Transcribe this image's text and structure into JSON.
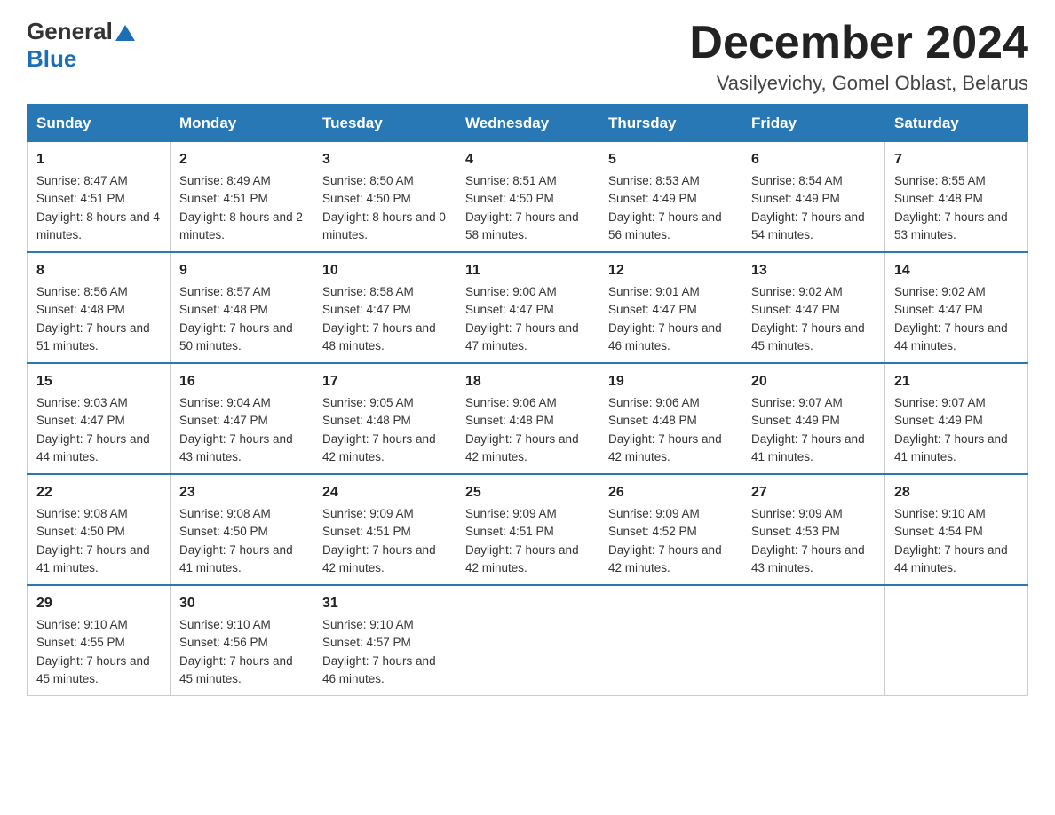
{
  "header": {
    "logo_general": "General",
    "logo_blue": "Blue",
    "month_title": "December 2024",
    "location": "Vasilyevichy, Gomel Oblast, Belarus"
  },
  "days_of_week": [
    "Sunday",
    "Monday",
    "Tuesday",
    "Wednesday",
    "Thursday",
    "Friday",
    "Saturday"
  ],
  "weeks": [
    [
      {
        "day": "1",
        "sunrise": "8:47 AM",
        "sunset": "4:51 PM",
        "daylight": "8 hours and 4 minutes."
      },
      {
        "day": "2",
        "sunrise": "8:49 AM",
        "sunset": "4:51 PM",
        "daylight": "8 hours and 2 minutes."
      },
      {
        "day": "3",
        "sunrise": "8:50 AM",
        "sunset": "4:50 PM",
        "daylight": "8 hours and 0 minutes."
      },
      {
        "day": "4",
        "sunrise": "8:51 AM",
        "sunset": "4:50 PM",
        "daylight": "7 hours and 58 minutes."
      },
      {
        "day": "5",
        "sunrise": "8:53 AM",
        "sunset": "4:49 PM",
        "daylight": "7 hours and 56 minutes."
      },
      {
        "day": "6",
        "sunrise": "8:54 AM",
        "sunset": "4:49 PM",
        "daylight": "7 hours and 54 minutes."
      },
      {
        "day": "7",
        "sunrise": "8:55 AM",
        "sunset": "4:48 PM",
        "daylight": "7 hours and 53 minutes."
      }
    ],
    [
      {
        "day": "8",
        "sunrise": "8:56 AM",
        "sunset": "4:48 PM",
        "daylight": "7 hours and 51 minutes."
      },
      {
        "day": "9",
        "sunrise": "8:57 AM",
        "sunset": "4:48 PM",
        "daylight": "7 hours and 50 minutes."
      },
      {
        "day": "10",
        "sunrise": "8:58 AM",
        "sunset": "4:47 PM",
        "daylight": "7 hours and 48 minutes."
      },
      {
        "day": "11",
        "sunrise": "9:00 AM",
        "sunset": "4:47 PM",
        "daylight": "7 hours and 47 minutes."
      },
      {
        "day": "12",
        "sunrise": "9:01 AM",
        "sunset": "4:47 PM",
        "daylight": "7 hours and 46 minutes."
      },
      {
        "day": "13",
        "sunrise": "9:02 AM",
        "sunset": "4:47 PM",
        "daylight": "7 hours and 45 minutes."
      },
      {
        "day": "14",
        "sunrise": "9:02 AM",
        "sunset": "4:47 PM",
        "daylight": "7 hours and 44 minutes."
      }
    ],
    [
      {
        "day": "15",
        "sunrise": "9:03 AM",
        "sunset": "4:47 PM",
        "daylight": "7 hours and 44 minutes."
      },
      {
        "day": "16",
        "sunrise": "9:04 AM",
        "sunset": "4:47 PM",
        "daylight": "7 hours and 43 minutes."
      },
      {
        "day": "17",
        "sunrise": "9:05 AM",
        "sunset": "4:48 PM",
        "daylight": "7 hours and 42 minutes."
      },
      {
        "day": "18",
        "sunrise": "9:06 AM",
        "sunset": "4:48 PM",
        "daylight": "7 hours and 42 minutes."
      },
      {
        "day": "19",
        "sunrise": "9:06 AM",
        "sunset": "4:48 PM",
        "daylight": "7 hours and 42 minutes."
      },
      {
        "day": "20",
        "sunrise": "9:07 AM",
        "sunset": "4:49 PM",
        "daylight": "7 hours and 41 minutes."
      },
      {
        "day": "21",
        "sunrise": "9:07 AM",
        "sunset": "4:49 PM",
        "daylight": "7 hours and 41 minutes."
      }
    ],
    [
      {
        "day": "22",
        "sunrise": "9:08 AM",
        "sunset": "4:50 PM",
        "daylight": "7 hours and 41 minutes."
      },
      {
        "day": "23",
        "sunrise": "9:08 AM",
        "sunset": "4:50 PM",
        "daylight": "7 hours and 41 minutes."
      },
      {
        "day": "24",
        "sunrise": "9:09 AM",
        "sunset": "4:51 PM",
        "daylight": "7 hours and 42 minutes."
      },
      {
        "day": "25",
        "sunrise": "9:09 AM",
        "sunset": "4:51 PM",
        "daylight": "7 hours and 42 minutes."
      },
      {
        "day": "26",
        "sunrise": "9:09 AM",
        "sunset": "4:52 PM",
        "daylight": "7 hours and 42 minutes."
      },
      {
        "day": "27",
        "sunrise": "9:09 AM",
        "sunset": "4:53 PM",
        "daylight": "7 hours and 43 minutes."
      },
      {
        "day": "28",
        "sunrise": "9:10 AM",
        "sunset": "4:54 PM",
        "daylight": "7 hours and 44 minutes."
      }
    ],
    [
      {
        "day": "29",
        "sunrise": "9:10 AM",
        "sunset": "4:55 PM",
        "daylight": "7 hours and 45 minutes."
      },
      {
        "day": "30",
        "sunrise": "9:10 AM",
        "sunset": "4:56 PM",
        "daylight": "7 hours and 45 minutes."
      },
      {
        "day": "31",
        "sunrise": "9:10 AM",
        "sunset": "4:57 PM",
        "daylight": "7 hours and 46 minutes."
      },
      null,
      null,
      null,
      null
    ]
  ]
}
